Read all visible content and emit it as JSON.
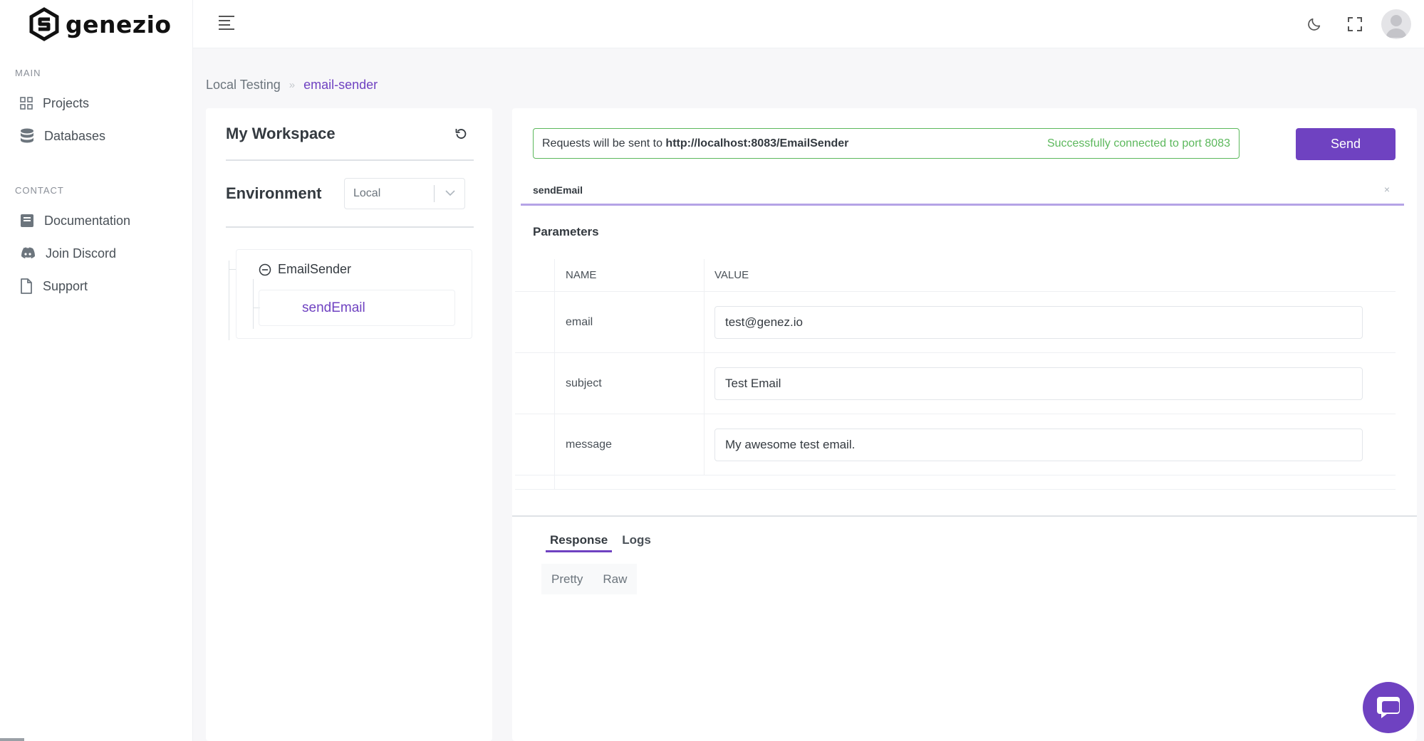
{
  "app": {
    "logo_text": "genezio"
  },
  "sidebar": {
    "sections": [
      {
        "title": "MAIN",
        "items": [
          {
            "label": "Projects",
            "icon": "grid-icon"
          },
          {
            "label": "Databases",
            "icon": "database-icon"
          }
        ]
      },
      {
        "title": "CONTACT",
        "items": [
          {
            "label": "Documentation",
            "icon": "book-icon"
          },
          {
            "label": "Join Discord",
            "icon": "discord-icon"
          },
          {
            "label": "Support",
            "icon": "file-icon"
          }
        ]
      }
    ]
  },
  "breadcrumb": {
    "parent": "Local Testing",
    "separator": "»",
    "current": "email-sender"
  },
  "workspace": {
    "title": "My Workspace",
    "environment_label": "Environment",
    "environment_value": "Local",
    "tree": {
      "class_name": "EmailSender",
      "method_name": "sendEmail"
    }
  },
  "request": {
    "url_prefix": "Requests will be sent to ",
    "url": "http://localhost:8083/EmailSender",
    "status": "Successfully connected to port 8083",
    "send_label": "Send",
    "tab_name": "sendEmail",
    "tab_close": "×",
    "params_title": "Parameters",
    "columns": {
      "name": "NAME",
      "value": "VALUE"
    },
    "params": [
      {
        "name": "email",
        "value": "test@genez.io"
      },
      {
        "name": "subject",
        "value": "Test Email"
      },
      {
        "name": "message",
        "value": "My awesome test email."
      }
    ]
  },
  "response": {
    "tabs": [
      "Response",
      "Logs"
    ],
    "formats": [
      "Pretty",
      "Raw"
    ]
  },
  "colors": {
    "accent": "#6f42c1",
    "success": "#5cb85c"
  }
}
